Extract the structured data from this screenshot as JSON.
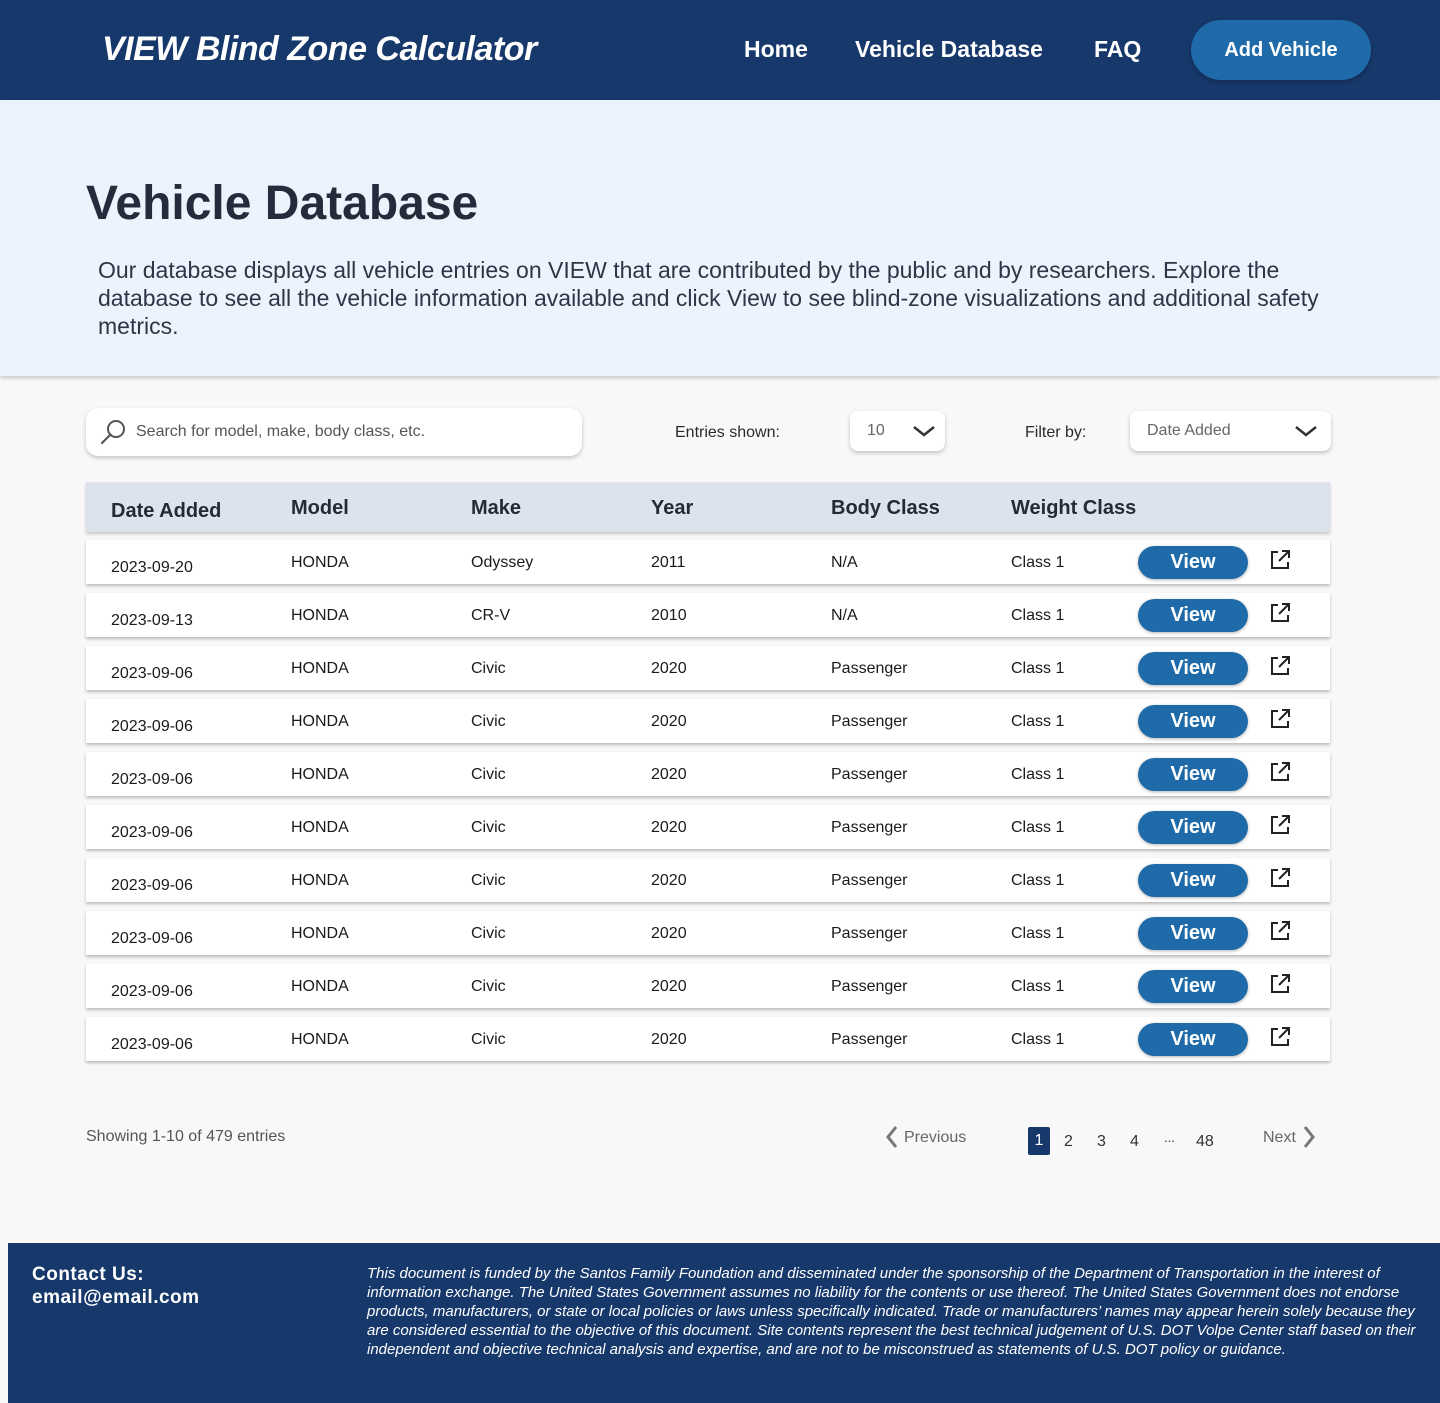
{
  "header": {
    "brand": "VIEW Blind Zone Calculator",
    "nav": [
      "Home",
      "Vehicle Database",
      "FAQ"
    ],
    "add_vehicle": "Add Vehicle"
  },
  "hero": {
    "title": "Vehicle Database",
    "description": "Our database displays all vehicle entries on VIEW that are contributed by the public and by researchers. Explore the database to see all the vehicle information available and click View to see blind-zone visualizations and additional safety metrics."
  },
  "controls": {
    "search_placeholder": "Search for model, make, body class, etc.",
    "entries_label": "Entries shown:",
    "entries_value": "10",
    "filter_label": "Filter by:",
    "filter_value": "Date Added"
  },
  "table": {
    "headers": [
      "Date Added",
      "Model",
      "Make",
      "Year",
      "Body Class",
      "Weight Class"
    ],
    "view_label": "View",
    "rows": [
      {
        "date": "2023-09-20",
        "model": "HONDA",
        "make": "Odyssey",
        "year": "2011",
        "body": "N/A",
        "weight": "Class 1"
      },
      {
        "date": "2023-09-13",
        "model": "HONDA",
        "make": "CR-V",
        "year": "2010",
        "body": "N/A",
        "weight": "Class 1"
      },
      {
        "date": "2023-09-06",
        "model": "HONDA",
        "make": "Civic",
        "year": "2020",
        "body": "Passenger",
        "weight": "Class 1"
      },
      {
        "date": "2023-09-06",
        "model": "HONDA",
        "make": "Civic",
        "year": "2020",
        "body": "Passenger",
        "weight": "Class 1"
      },
      {
        "date": "2023-09-06",
        "model": "HONDA",
        "make": "Civic",
        "year": "2020",
        "body": "Passenger",
        "weight": "Class 1"
      },
      {
        "date": "2023-09-06",
        "model": "HONDA",
        "make": "Civic",
        "year": "2020",
        "body": "Passenger",
        "weight": "Class 1"
      },
      {
        "date": "2023-09-06",
        "model": "HONDA",
        "make": "Civic",
        "year": "2020",
        "body": "Passenger",
        "weight": "Class 1"
      },
      {
        "date": "2023-09-06",
        "model": "HONDA",
        "make": "Civic",
        "year": "2020",
        "body": "Passenger",
        "weight": "Class 1"
      },
      {
        "date": "2023-09-06",
        "model": "HONDA",
        "make": "Civic",
        "year": "2020",
        "body": "Passenger",
        "weight": "Class 1"
      },
      {
        "date": "2023-09-06",
        "model": "HONDA",
        "make": "Civic",
        "year": "2020",
        "body": "Passenger",
        "weight": "Class 1"
      }
    ]
  },
  "pagination": {
    "showing": "Showing 1-10 of 479 entries",
    "previous": "Previous",
    "next": "Next",
    "pages": [
      "1",
      "2",
      "3",
      "4",
      "...",
      "48"
    ],
    "current": "1"
  },
  "footer": {
    "contact_label": "Contact Us:",
    "contact_email": "email@email.com",
    "disclaimer": "This document is funded by the Santos Family Foundation and disseminated under the sponsorship of the Department of Transportation in the interest of information exchange. The United States Government assumes no liability for the contents or use thereof. The United States Government does not endorse products, manufacturers, or state or local policies or laws unless specifically indicated. Trade or manufacturers’ names may appear herein solely because they are considered essential to the objective of this document. Site contents represent the best technical judgement of U.S. DOT Volpe Center staff based on their independent and objective technical analysis and expertise, and are not to be misconstrued as statements of U.S. DOT policy or guidance."
  },
  "colors": {
    "navy": "#17386b",
    "button_blue": "#1f6aa8",
    "hero_bg": "#ebf3fc",
    "table_header_bg": "#dde3ec"
  },
  "icons": {
    "search": "search-icon",
    "dropdown": "chevron-down-icon",
    "external": "external-link-icon",
    "prev": "chevron-left-icon",
    "next": "chevron-right-icon"
  }
}
